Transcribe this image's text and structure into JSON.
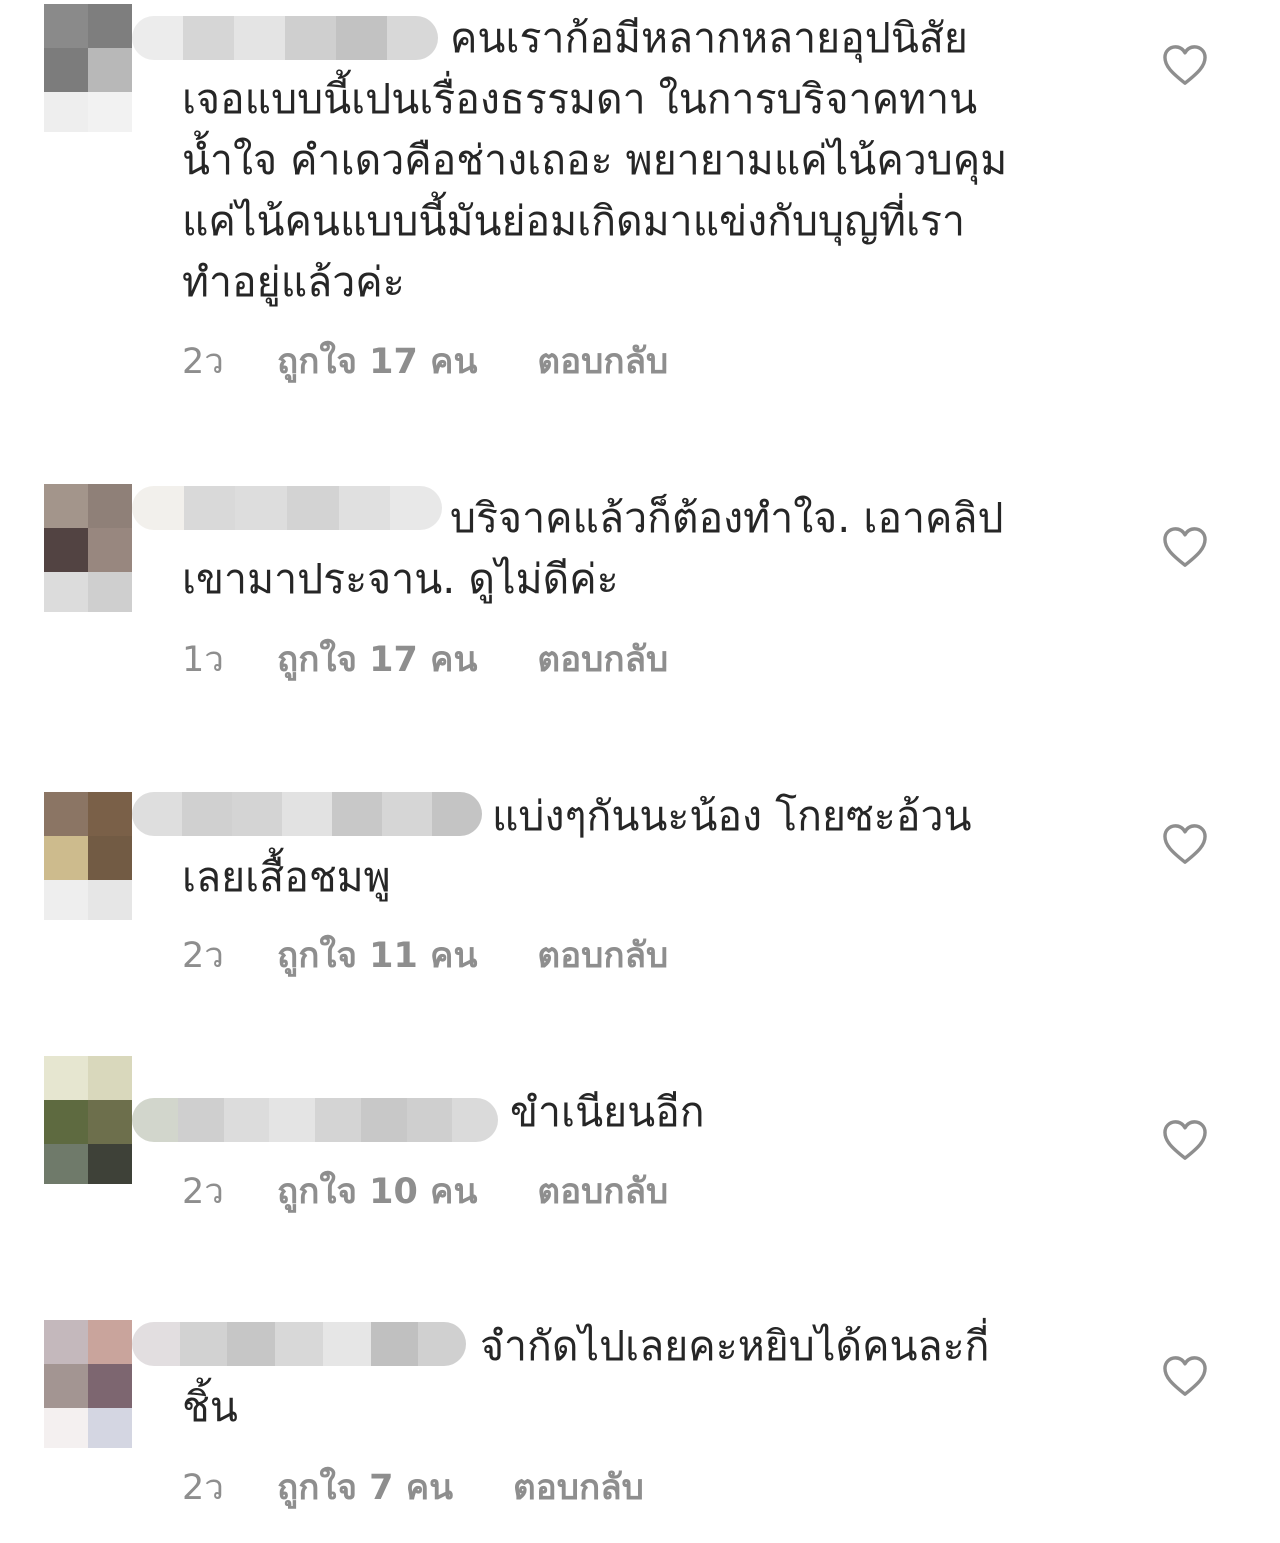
{
  "icons": {
    "like": "heart-outline-icon"
  },
  "colors": {
    "text": "#262626",
    "meta": "#8e8e8e",
    "background": "#ffffff"
  },
  "comments": [
    {
      "text": "คนเราก้อมีหลากหลายอุปนิสัย\nเจอแบบนี้เปนเรื่องธรรมดา ในการบริจาคทาน\nน้ำใจ คำเดวคือช่างเถอะ พยายามแค่ไน้ควบคุม\nแค่ไน้คนแบบนี้มันย่อมเกิดมาแข่งกับบุญที่เรา\nทำอยู่แล้วค่ะ",
      "time": "2ว",
      "likes": "ถูกใจ 17 คน",
      "reply": "ตอบกลับ"
    },
    {
      "text": "บริจาคแล้วก็ต้องทำใจ. เอาคลิป\nเขามาประจาน. ดูไม่ดีค่ะ",
      "time": "1ว",
      "likes": "ถูกใจ 17 คน",
      "reply": "ตอบกลับ"
    },
    {
      "text": "แบ่งๆกันนะน้อง โกยซะอ้วน\nเลยเสื้อชมพู",
      "time": "2ว",
      "likes": "ถูกใจ 11 คน",
      "reply": "ตอบกลับ"
    },
    {
      "text": "ขำเนียนอีก",
      "time": "2ว",
      "likes": "ถูกใจ 10 คน",
      "reply": "ตอบกลับ"
    },
    {
      "text": "จำกัดไปเลยคะหยิบได้คนละกี่\nชิ้น",
      "time": "2ว",
      "likes": "ถูกใจ 7 คน",
      "reply": "ตอบกลับ"
    }
  ]
}
